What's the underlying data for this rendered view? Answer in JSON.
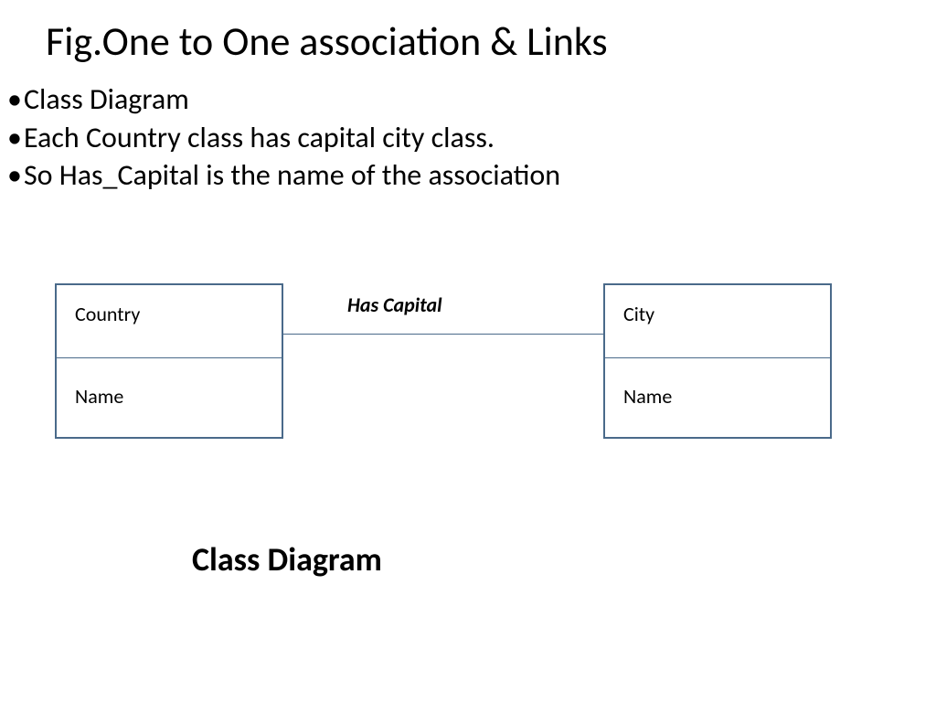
{
  "title": "Fig.One to One association & Links",
  "bullets": {
    "item0": "Class Diagram",
    "item1": "Each Country class has capital city class.",
    "item2": "So Has_Capital is the name of the association"
  },
  "diagram": {
    "leftClass": {
      "name": "Country",
      "attribute": "Name"
    },
    "rightClass": {
      "name": "City",
      "attribute": "Name"
    },
    "associationLabel": "Has Capital"
  },
  "caption": "Class Diagram"
}
